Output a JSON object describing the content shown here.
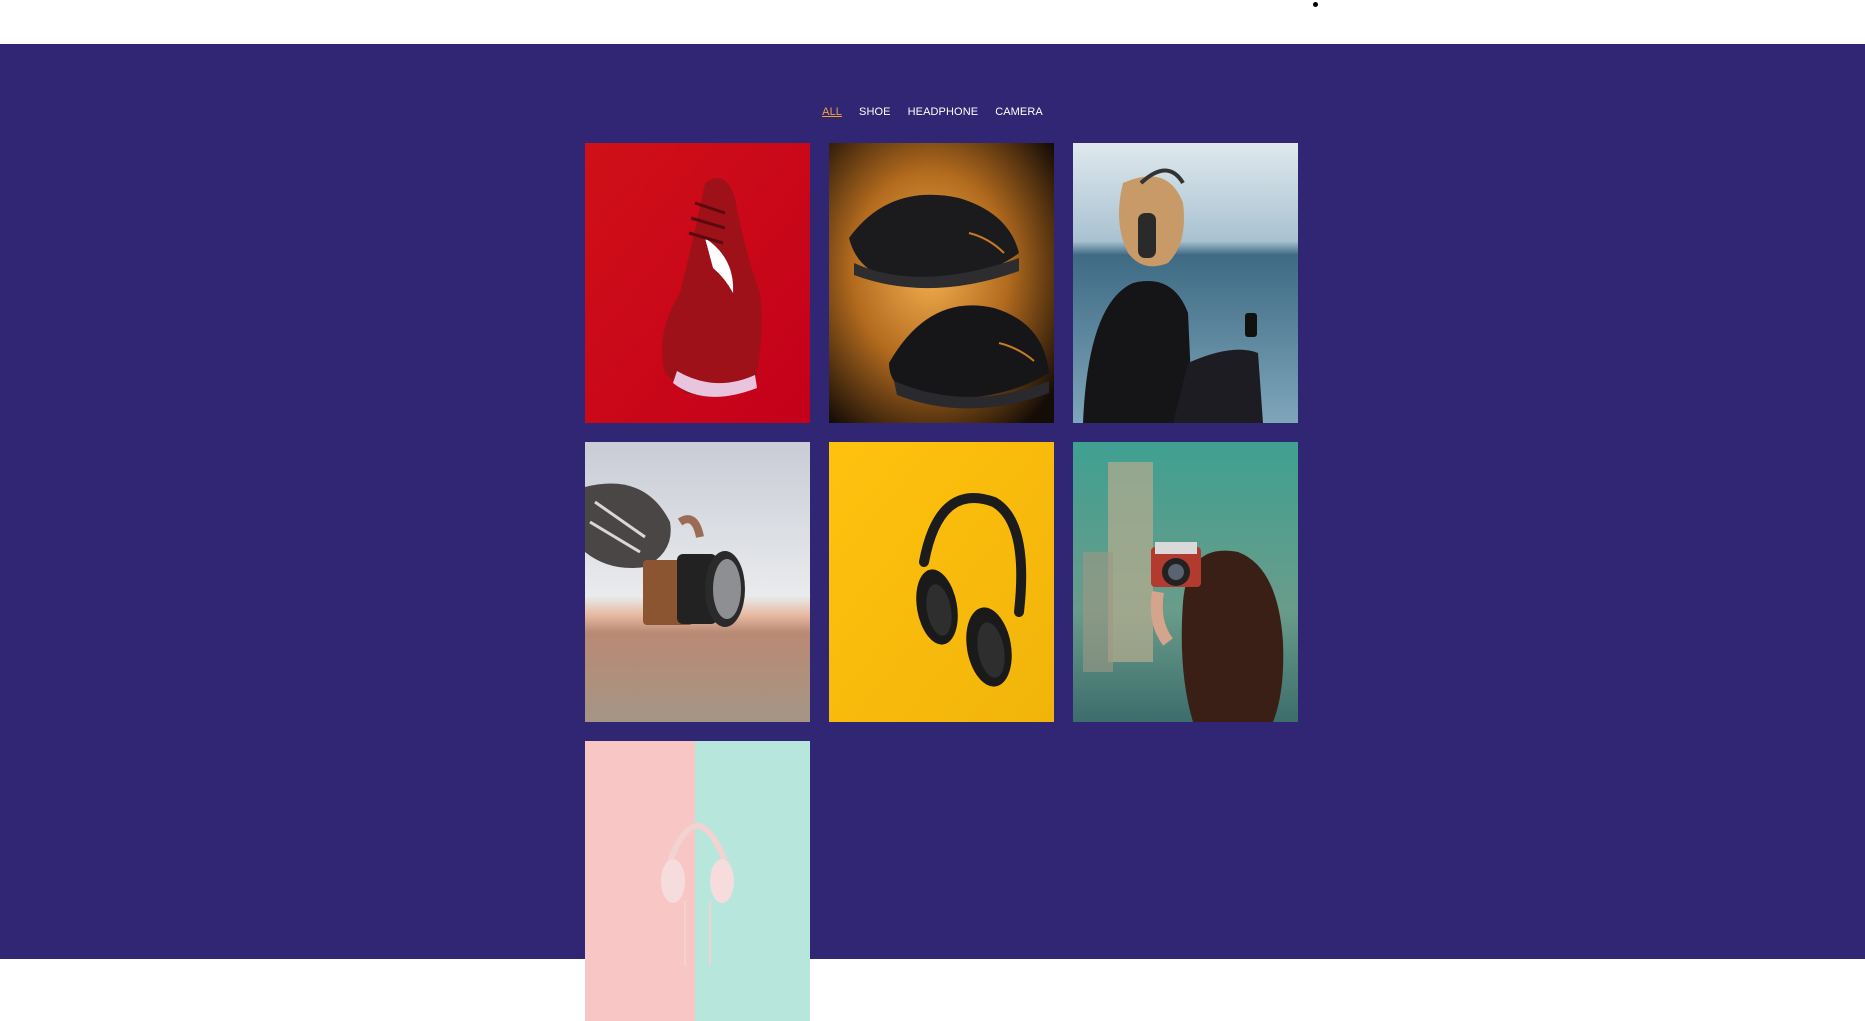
{
  "filters": [
    {
      "label": "ALL",
      "active": true
    },
    {
      "label": "SHOE",
      "active": false
    },
    {
      "label": "HEADPHONE",
      "active": false
    },
    {
      "label": "CAMERA",
      "active": false
    }
  ],
  "gallery": [
    {
      "category": "SHOE",
      "subject": "red-sneaker"
    },
    {
      "category": "SHOE",
      "subject": "black-sneakers"
    },
    {
      "category": "HEADPHONE",
      "subject": "woman-with-headphones-by-sea"
    },
    {
      "category": "CAMERA",
      "subject": "hand-holding-camera-desert"
    },
    {
      "category": "HEADPHONE",
      "subject": "black-headphones-on-yellow"
    },
    {
      "category": "CAMERA",
      "subject": "woman-with-vintage-camera"
    },
    {
      "category": "HEADPHONE",
      "subject": "pink-headphones-on-split-background"
    }
  ],
  "colors": {
    "page_background": "#312673",
    "active_filter": "#f0a23a",
    "filter_text": "#ffffff"
  }
}
